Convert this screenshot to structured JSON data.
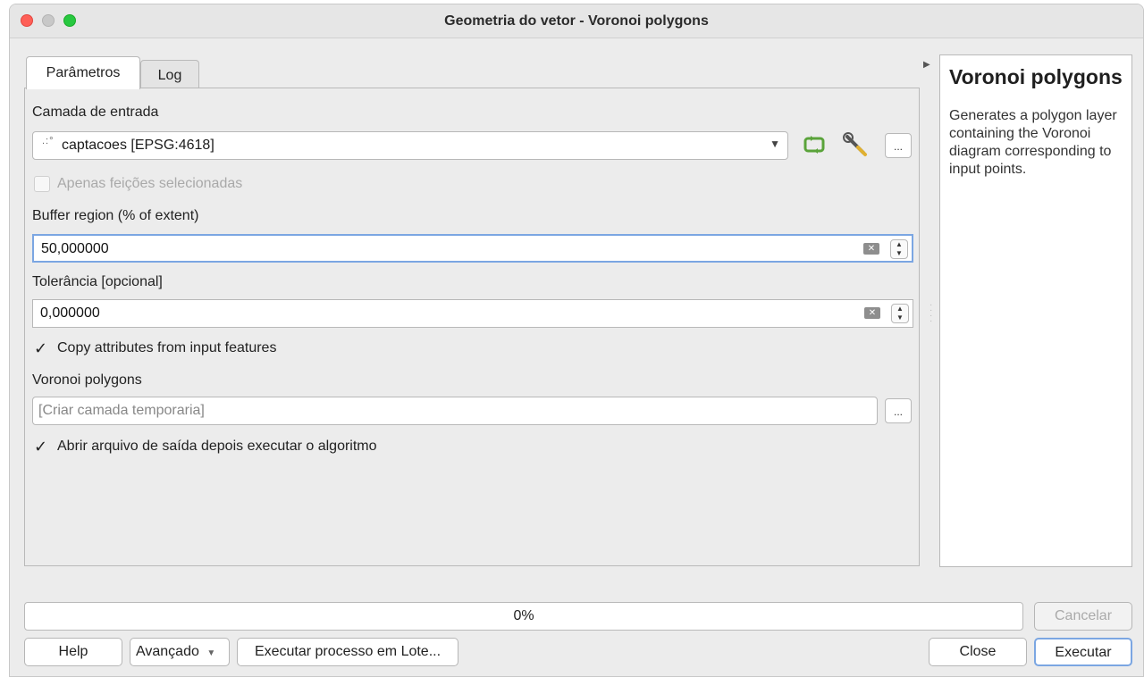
{
  "window": {
    "title": "Geometria do vetor - Voronoi polygons"
  },
  "tabs": [
    {
      "label": "Parâmetros"
    },
    {
      "label": "Log"
    }
  ],
  "params": {
    "input_layer_label": "Camada de entrada",
    "input_layer_value": "captacoes [EPSG:4618]",
    "point_glyph": ".:°",
    "dots_label": "...",
    "selected_only_label": "Apenas feições selecionadas",
    "buffer_label": "Buffer region (% of extent)",
    "buffer_value": "50,000000",
    "tolerance_label": "Tolerância [opcional]",
    "tolerance_value": "0,000000",
    "copy_attrs_label": "Copy attributes from input features",
    "output_label": "Voronoi polygons",
    "output_placeholder": "[Criar camada temporaria]",
    "open_output_label": "Abrir arquivo de saída depois executar o algoritmo"
  },
  "help": {
    "title": "Voronoi polygons",
    "text": "Generates a polygon layer containing the Voronoi diagram corresponding to input points."
  },
  "progress": {
    "text": "0%",
    "value": 0
  },
  "buttons": {
    "cancel": "Cancelar",
    "help": "Help",
    "advanced": "Avançado",
    "batch": "Executar processo em Lote...",
    "close": "Close",
    "run": "Executar"
  },
  "colors": {
    "focus": "#7ba6e2",
    "refresh_icon": "#5aa33a"
  }
}
